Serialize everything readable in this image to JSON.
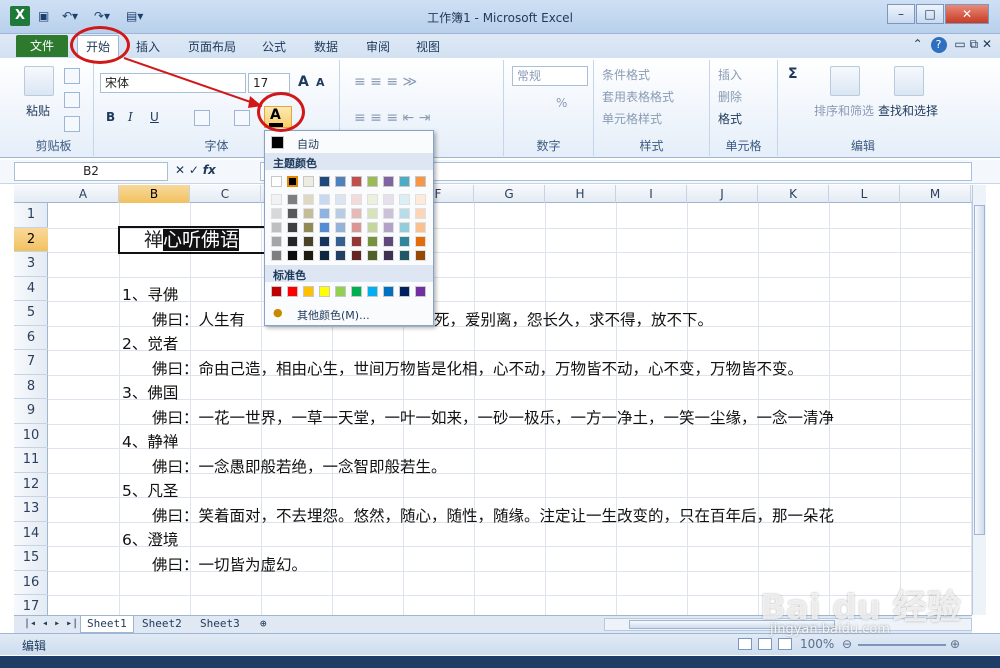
{
  "window": {
    "title": "工作簿1 - Microsoft Excel"
  },
  "tabs": {
    "file": "文件",
    "items": [
      "开始",
      "插入",
      "页面布局",
      "公式",
      "数据",
      "审阅",
      "视图"
    ]
  },
  "ribbon": {
    "clipboard": {
      "paste": "粘贴",
      "label": "剪贴板"
    },
    "font": {
      "name": "宋体",
      "size": "17",
      "grow": "A",
      "shrink": "A",
      "bold": "B",
      "italic": "I",
      "underline": "U",
      "label": "字体",
      "fontcolor": "A"
    },
    "number": {
      "format": "常规",
      "label": "数字",
      "percent": "%"
    },
    "styles": {
      "conditional": "条件格式",
      "table": "套用表格格式",
      "cell": "单元格样式",
      "label": "样式"
    },
    "cells": {
      "insert": "插入",
      "delete": "删除",
      "format": "格式",
      "label": "单元格"
    },
    "editing": {
      "sum": "Σ",
      "sort": "排序和筛选",
      "find": "查找和选择",
      "label": "编辑"
    }
  },
  "formula_bar": {
    "name_box": "B2",
    "fx": "fx",
    "value": "禅"
  },
  "columns": [
    "A",
    "B",
    "C",
    "D",
    "E",
    "F",
    "G",
    "H",
    "I",
    "J",
    "K",
    "L",
    "M"
  ],
  "selected_column": "B",
  "rows": [
    "1",
    "2",
    "3",
    "4",
    "5",
    "6",
    "7",
    "8",
    "9",
    "10",
    "11",
    "12",
    "13",
    "14",
    "15",
    "16",
    "17"
  ],
  "selected_row": "2",
  "cells": {
    "b2_pre": "禅",
    "b2_sel": "心听佛语",
    "r4": "1、寻佛",
    "r5_a": "佛曰：人生有",
    "r5_b": "死，爱别离，怨长久，求不得，放不下。",
    "r6": "2、觉者",
    "r7": "佛曰：命由己造，相由心生，世间万物皆是化相，心不动，万物皆不动，心不变，万物皆不变。",
    "r8": "3、佛国",
    "r9": "佛曰：一花一世界，一草一天堂，一叶一如来，一砂一极乐，一方一净土，一笑一尘缘，一念一清净",
    "r10": "4、静禅",
    "r11": "佛曰：一念愚即般若绝，一念智即般若生。",
    "r12": "5、凡圣",
    "r13": "佛曰：笑着面对，不去埋怨。悠然，随心，随性，随缘。注定让一生改变的，只在百年后，那一朵花",
    "r14": "6、澄境",
    "r15": "佛曰：一切皆为虚幻。"
  },
  "sheets": [
    "Sheet1",
    "Sheet2",
    "Sheet3"
  ],
  "status": {
    "mode": "编辑",
    "zoom": "100%"
  },
  "color_popup": {
    "auto": "自动",
    "theme_header": "主题颜色",
    "standard_header": "标准色",
    "more": "其他颜色(M)...",
    "theme_top": [
      "#ffffff",
      "#000000",
      "#eeece1",
      "#1f497d",
      "#4f81bd",
      "#c0504d",
      "#9bbb59",
      "#8064a2",
      "#4bacc6",
      "#f79646"
    ],
    "theme_shades": [
      [
        "#f2f2f2",
        "#7f7f7f",
        "#ddd9c3",
        "#c6d9f0",
        "#dbe5f1",
        "#f2dcdb",
        "#ebf1dd",
        "#e5e0ec",
        "#dbeef3",
        "#fdeada"
      ],
      [
        "#d8d8d8",
        "#595959",
        "#c4bd97",
        "#8db3e2",
        "#b8cce4",
        "#e5b9b7",
        "#d7e3bc",
        "#ccc1d9",
        "#b7dde8",
        "#fbd5b5"
      ],
      [
        "#bfbfbf",
        "#3f3f3f",
        "#938953",
        "#548dd4",
        "#95b3d7",
        "#d99694",
        "#c3d69b",
        "#b2a2c7",
        "#92cddc",
        "#fac08f"
      ],
      [
        "#a5a5a5",
        "#262626",
        "#494429",
        "#17365d",
        "#366092",
        "#953734",
        "#76923c",
        "#5f497a",
        "#31859b",
        "#e36c09"
      ],
      [
        "#7f7f7f",
        "#0c0c0c",
        "#1d1b10",
        "#0f243e",
        "#244061",
        "#632423",
        "#4f6128",
        "#3f3151",
        "#205867",
        "#974806"
      ]
    ],
    "standard": [
      "#c00000",
      "#ff0000",
      "#ffc000",
      "#ffff00",
      "#92d050",
      "#00b050",
      "#00b0f0",
      "#0070c0",
      "#002060",
      "#7030a0"
    ]
  },
  "watermark": {
    "brand": "Bai du 经验",
    "url": "jingyan.baidu.com"
  }
}
